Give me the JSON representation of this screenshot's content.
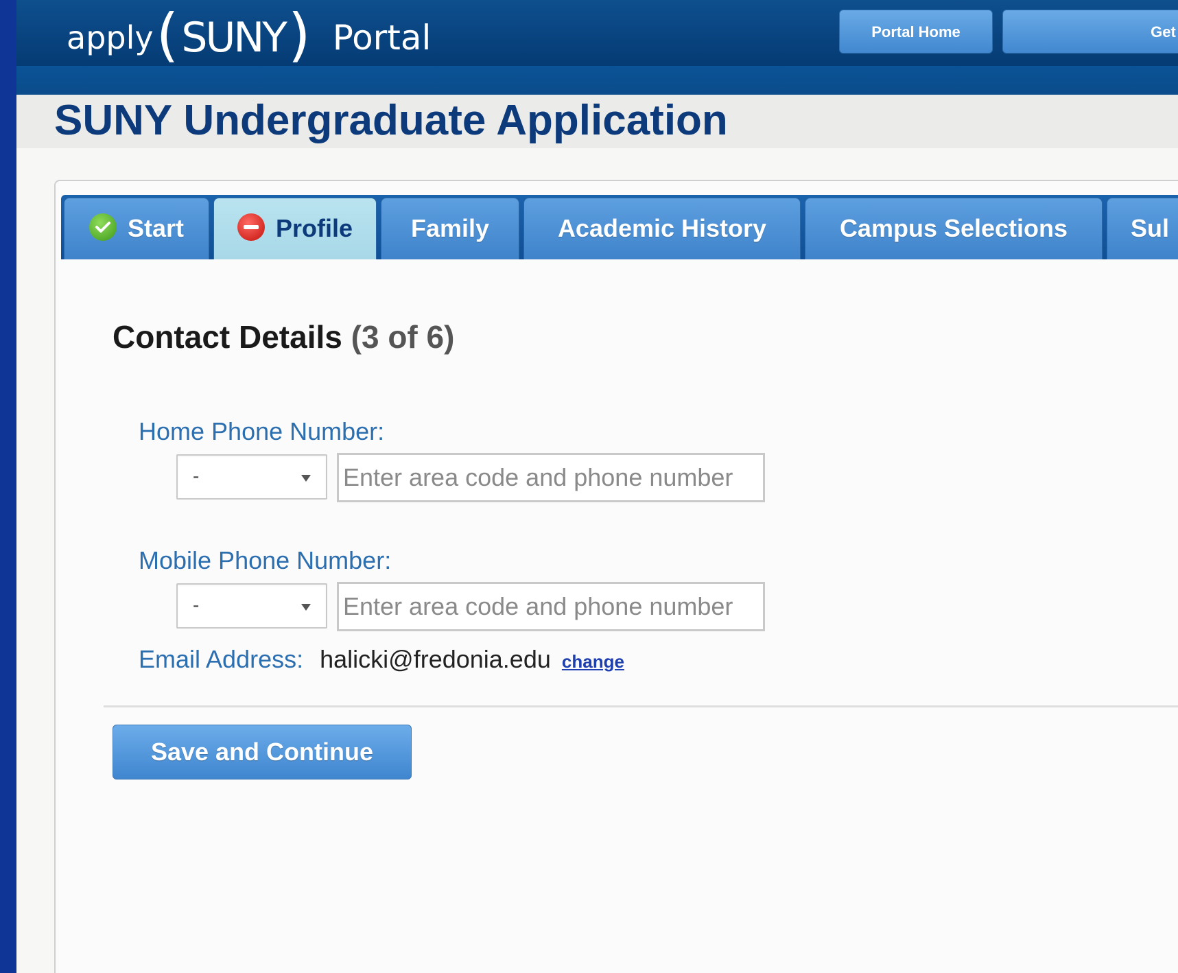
{
  "portal": {
    "logo_apply": "apply",
    "logo_paren_open": "(",
    "logo_suny": "SUNY",
    "logo_paren_close": ")",
    "logo_portal": "Portal",
    "nav": {
      "home_label": "Portal Home",
      "get_label": "Get I"
    }
  },
  "page": {
    "title": "SUNY Undergraduate Application"
  },
  "tabs": [
    {
      "label": "Start",
      "status": "complete",
      "icon": "check-circle-icon"
    },
    {
      "label": "Profile",
      "status": "error",
      "icon": "error-circle-icon",
      "active": true
    },
    {
      "label": "Family"
    },
    {
      "label": "Academic History"
    },
    {
      "label": "Campus Selections"
    },
    {
      "label": "Sul"
    }
  ],
  "section": {
    "title": "Contact Details",
    "progress": "(3 of 6)"
  },
  "form": {
    "home_phone": {
      "label": "Home Phone Number:",
      "country_value": "-",
      "placeholder": "Enter area code and phone number"
    },
    "mobile_phone": {
      "label": "Mobile Phone Number:",
      "country_value": "-",
      "placeholder": "Enter area code and phone number"
    },
    "email": {
      "label": "Email Address:",
      "value": "halicki@fredonia.edu",
      "change_label": "change"
    },
    "save_label": "Save and Continue"
  },
  "colors": {
    "frame_blue": "#0f3597",
    "header_blue": "#053b74",
    "title_navy": "#0c3a7a",
    "tab_blue": "#4a8fd4",
    "tab_active": "#b0dbea",
    "label_blue": "#2c6fb0",
    "complete_green": "#4caf24",
    "error_red": "#d8231c"
  }
}
